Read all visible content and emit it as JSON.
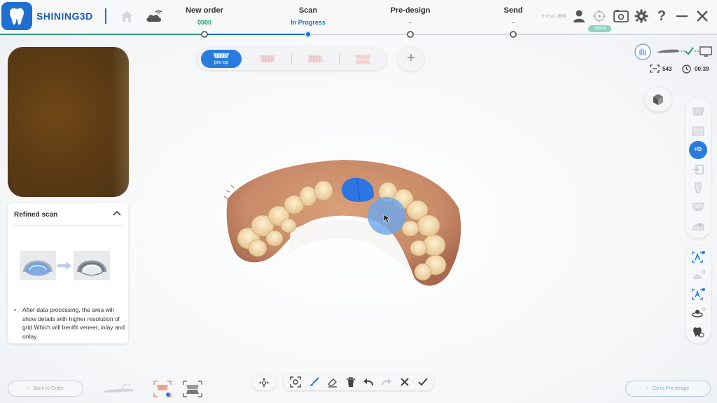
{
  "app": {
    "brand": "SHINING3D"
  },
  "steps": [
    {
      "title": "New order",
      "sub": "0000"
    },
    {
      "title": "Scan",
      "sub": "In Progress"
    },
    {
      "title": "Pre-design",
      "sub": "-"
    },
    {
      "title": "Send",
      "sub": "-"
    }
  ],
  "header": {
    "user_name": "たかはし歯科",
    "status_badge": "Online"
  },
  "mode_selector": {
    "active_label": "pre-op",
    "add_label": "+"
  },
  "status": {
    "frame_count": "543",
    "elapsed_time": "00:39"
  },
  "info_card": {
    "title": "Refined scan",
    "bullet": "•",
    "description": "After data processing, the area will show details with higher resolution of grid.Which will benifit veneer, inlay and onlay."
  },
  "right_toolbar": {
    "hd_label": "HD"
  },
  "footer": {
    "back_label": "Back to Order",
    "next_label": "Go to Pre-design"
  },
  "colors": {
    "accent": "#1f6fd1",
    "success": "#2a9a72",
    "active_mode": "#2a7be0"
  },
  "icons": [
    "home-icon",
    "cloud-wifi-icon",
    "user-icon",
    "crosshair-icon",
    "camera-settings-icon",
    "gear-icon",
    "help-icon",
    "minimize-icon",
    "close-icon",
    "cube-view-icon",
    "chevron-up-icon",
    "clock-icon",
    "frame-count-icon",
    "move-icon",
    "lasso-select-icon",
    "brush-icon",
    "eraser-icon",
    "trash-icon",
    "undo-icon",
    "redo-icon",
    "cancel-icon",
    "confirm-icon"
  ]
}
